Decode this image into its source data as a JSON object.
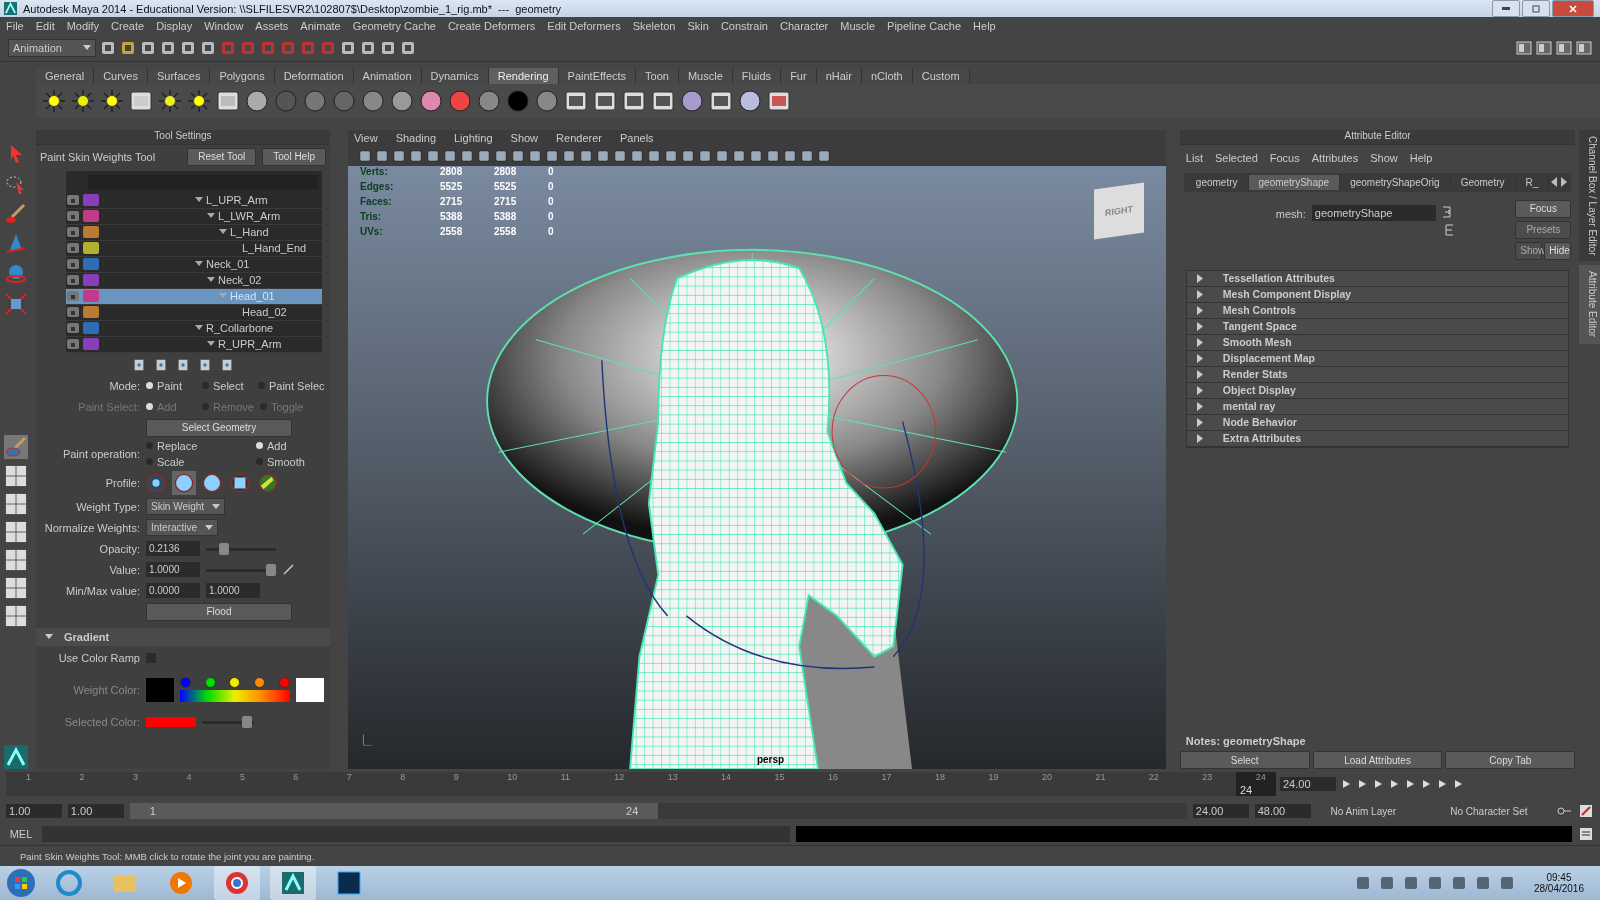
{
  "window": {
    "title": "Autodesk Maya 2014 - Educational Version: \\\\SLFILESVR2\\102807$\\Desktop\\zombie_1_rig.mb*  ---  geometry"
  },
  "menu": [
    "File",
    "Edit",
    "Modify",
    "Create",
    "Display",
    "Window",
    "Assets",
    "Animate",
    "Geometry Cache",
    "Create Deformers",
    "Edit Deformers",
    "Skeleton",
    "Skin",
    "Constrain",
    "Character",
    "Muscle",
    "Pipeline Cache",
    "Help"
  ],
  "status_line": {
    "menu_set": "Animation"
  },
  "shelf_tabs": [
    {
      "label": "General",
      "selected": false
    },
    {
      "label": "Curves",
      "selected": false
    },
    {
      "label": "Surfaces",
      "selected": false
    },
    {
      "label": "Polygons",
      "selected": false
    },
    {
      "label": "Deformation",
      "selected": false
    },
    {
      "label": "Animation",
      "selected": false
    },
    {
      "label": "Dynamics",
      "selected": false
    },
    {
      "label": "Rendering",
      "selected": true
    },
    {
      "label": "PaintEffects",
      "selected": false
    },
    {
      "label": "Toon",
      "selected": false
    },
    {
      "label": "Muscle",
      "selected": false
    },
    {
      "label": "Fluids",
      "selected": false
    },
    {
      "label": "Fur",
      "selected": false
    },
    {
      "label": "nHair",
      "selected": false
    },
    {
      "label": "nCloth",
      "selected": false
    },
    {
      "label": "Custom",
      "selected": false
    }
  ],
  "tool_settings": {
    "header": "Tool Settings",
    "tool_name": "Paint Skin Weights Tool",
    "buttons": [
      "Reset Tool",
      "Tool Help"
    ],
    "joints": [
      {
        "name": "L_UPR_Arm",
        "color": "#8a3fb8",
        "selected": false,
        "expanded": true,
        "children": [
          {
            "name": "L_LWR_Arm",
            "color": "#c03c8a",
            "selected": false,
            "expanded": true,
            "children": [
              {
                "name": "L_Hand",
                "color": "#b87a35",
                "selected": false,
                "expanded": true,
                "children": [
                  {
                    "name": "L_Hand_End",
                    "color": "#b5b034",
                    "selected": false
                  }
                ]
              }
            ]
          }
        ]
      },
      {
        "name": "Neck_01",
        "color": "#2f6db5",
        "selected": false,
        "expanded": true,
        "children": [
          {
            "name": "Neck_02",
            "color": "#8a3fb8",
            "selected": false,
            "expanded": true,
            "children": [
              {
                "name": "Head_01",
                "color": "#c03c8a",
                "selected": true,
                "expanded": true,
                "children": [
                  {
                    "name": "Head_02",
                    "color": "#b87a35",
                    "selected": false
                  }
                ]
              }
            ]
          }
        ]
      },
      {
        "name": "R_Collarbone",
        "color": "#2f6db5",
        "selected": false,
        "expanded": true,
        "children": [
          {
            "name": "R_UPR_Arm",
            "color": "#8a3fb8",
            "selected": false,
            "expanded": true
          }
        ]
      }
    ],
    "radio_rows": [
      {
        "label": "Mode:",
        "disabled": false,
        "options": [
          {
            "label": "Paint",
            "selected": true
          },
          {
            "label": "Select",
            "selected": false
          },
          {
            "label": "Paint Selec",
            "selected": false
          }
        ]
      },
      {
        "label": "Paint Select:",
        "disabled": true,
        "options": [
          {
            "label": "Add",
            "selected": true
          },
          {
            "label": "Remove",
            "selected": false
          },
          {
            "label": "Toggle",
            "selected": false
          }
        ]
      }
    ],
    "select_geometry": "Select Geometry",
    "paint_operation": {
      "label": "Paint operation:",
      "options": [
        {
          "label": "Replace",
          "selected": false
        },
        {
          "label": "Add",
          "selected": true
        },
        {
          "label": "Scale",
          "selected": false
        },
        {
          "label": "Smooth",
          "selected": false
        }
      ]
    },
    "profile": {
      "label": "Profile:",
      "options": [
        {
          "kind": "soft",
          "selected": false
        },
        {
          "kind": "gaussian",
          "selected": true
        },
        {
          "kind": "solid",
          "selected": false
        },
        {
          "kind": "square",
          "selected": false
        },
        {
          "kind": "image",
          "selected": false
        }
      ]
    },
    "weight_type": {
      "label": "Weight Type:",
      "value": "Skin Weight"
    },
    "normalize": {
      "label": "Normalize Weights:",
      "value": "Interactive"
    },
    "opacity": {
      "label": "Opacity:",
      "value": "0.2136",
      "level": 0.21
    },
    "value": {
      "label": "Value:",
      "value": "1.0000",
      "level": 1
    },
    "min_max": {
      "label": "Min/Max value:",
      "min": "0.0000",
      "max": "1.0000"
    },
    "flood": "Flood",
    "gradient": {
      "title": "Gradient",
      "expanded": true,
      "use_color_ramp": {
        "label": "Use Color Ramp",
        "checked": false
      },
      "weight_color_label": "Weight Color:",
      "ramp": [
        {
          "color": "#0000ff"
        },
        {
          "color": "#00dd00"
        },
        {
          "color": "#eeee00"
        },
        {
          "color": "#ff8800"
        },
        {
          "color": "#ff0000"
        }
      ],
      "selected_color": {
        "label": "Selected Color:",
        "color": "#ff0000",
        "level": 0.95
      }
    }
  },
  "viewport": {
    "menu": [
      "View",
      "Shading",
      "Lighting",
      "Show",
      "Renderer",
      "Panels"
    ],
    "hud": [
      {
        "label": "Verts:",
        "values": [
          "2808",
          "2808",
          "0"
        ]
      },
      {
        "label": "Edges:",
        "values": [
          "5525",
          "5525",
          "0"
        ]
      },
      {
        "label": "Faces:",
        "values": [
          "2715",
          "2715",
          "0"
        ]
      },
      {
        "label": "Tris:",
        "values": [
          "5388",
          "5388",
          "0"
        ]
      },
      {
        "label": "UVs:",
        "values": [
          "2558",
          "2558",
          "0"
        ]
      }
    ],
    "view_cube": "RIGHT",
    "camera": "persp"
  },
  "attribute_editor": {
    "header": "Attribute Editor",
    "menu": [
      "List",
      "Selected",
      "Focus",
      "Attributes",
      "Show",
      "Help"
    ],
    "tabs": [
      {
        "label": "geometry",
        "selected": false
      },
      {
        "label": "geometryShape",
        "selected": true
      },
      {
        "label": "geometryShapeOrig",
        "selected": false
      },
      {
        "label": "Geometry",
        "selected": false
      },
      {
        "label": "R_",
        "selected": false
      }
    ],
    "mesh_label": "mesh:",
    "mesh_value": "geometryShape",
    "side_buttons": [
      {
        "label": "Focus",
        "disabled": false
      },
      {
        "label": "Presets",
        "disabled": true
      }
    ],
    "show_hide": [
      {
        "label": "Show",
        "disabled": true
      },
      {
        "label": "Hide",
        "disabled": false
      }
    ],
    "sections": [
      "Tessellation Attributes",
      "Mesh Component Display",
      "Mesh Controls",
      "Tangent Space",
      "Smooth Mesh",
      "Displacement Map",
      "Render Stats",
      "Object Display",
      "mental ray",
      "Node Behavior",
      "Extra Attributes"
    ],
    "notes": "Notes:  geometryShape",
    "buttons": [
      "Select",
      "Load Attributes",
      "Copy Tab"
    ]
  },
  "side_tabs": [
    {
      "label": "Channel Box / Layer Editor",
      "selected": false
    },
    {
      "label": "Attribute Editor",
      "selected": true
    }
  ],
  "timeline": {
    "ticks": [
      "1",
      "2",
      "3",
      "4",
      "5",
      "6",
      "7",
      "8",
      "9",
      "10",
      "11",
      "12",
      "13",
      "14",
      "15",
      "16",
      "17",
      "18",
      "19",
      "20",
      "21",
      "22",
      "23",
      "24"
    ],
    "current_frame": "24",
    "current_time": "24.00",
    "level": 1
  },
  "range": {
    "start": "1.00",
    "playback_start": "1.00",
    "slider_start": "1",
    "slider_end": "24",
    "level": 0.5,
    "playback_end": "24.00",
    "end": "48.00",
    "anim_layer": "No Anim Layer",
    "character_set": "No Character Set"
  },
  "command_line": {
    "label": "MEL"
  },
  "help_line": "Paint Skin Weights Tool: MMB click to rotate the joint you are painting.",
  "taskbar": {
    "time": "09:45",
    "date": "28/04/2016"
  }
}
